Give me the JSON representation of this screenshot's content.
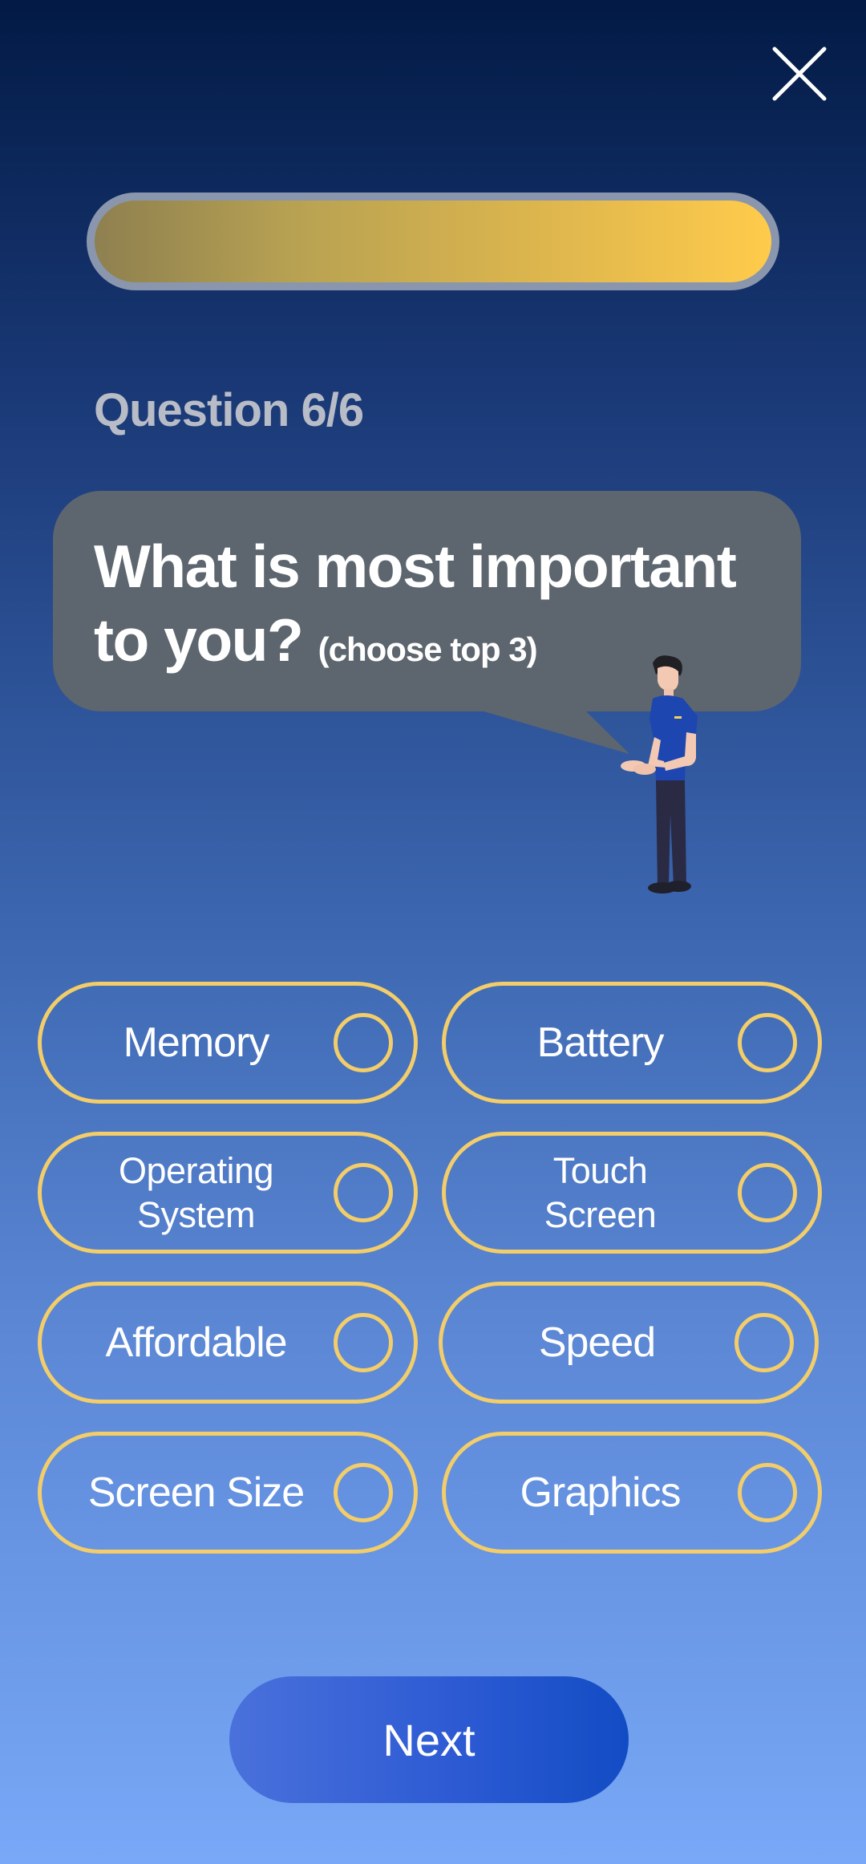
{
  "header": {
    "close_icon": "close-icon"
  },
  "progress": {
    "value": 1.0,
    "color_start": "#8e8050",
    "color_end": "#ffcb4b"
  },
  "question": {
    "counter": "Question 6/6",
    "text": "What is most important to you?",
    "hint": "(choose top 3)"
  },
  "illustration": {
    "icon": "salesperson-illustration"
  },
  "options": [
    {
      "label": "Memory",
      "selected": false
    },
    {
      "label": "Battery",
      "selected": false
    },
    {
      "label": "Operating System",
      "selected": false
    },
    {
      "label": "Touch Screen",
      "selected": false
    },
    {
      "label": "Affordable",
      "selected": false
    },
    {
      "label": "Speed",
      "selected": false
    },
    {
      "label": "Screen Size",
      "selected": false
    },
    {
      "label": "Graphics",
      "selected": false
    }
  ],
  "footer": {
    "next_label": "Next"
  },
  "colors": {
    "accent": "#f2cd6a",
    "bubble": "#5d666e",
    "button": "#2e5bd4"
  }
}
